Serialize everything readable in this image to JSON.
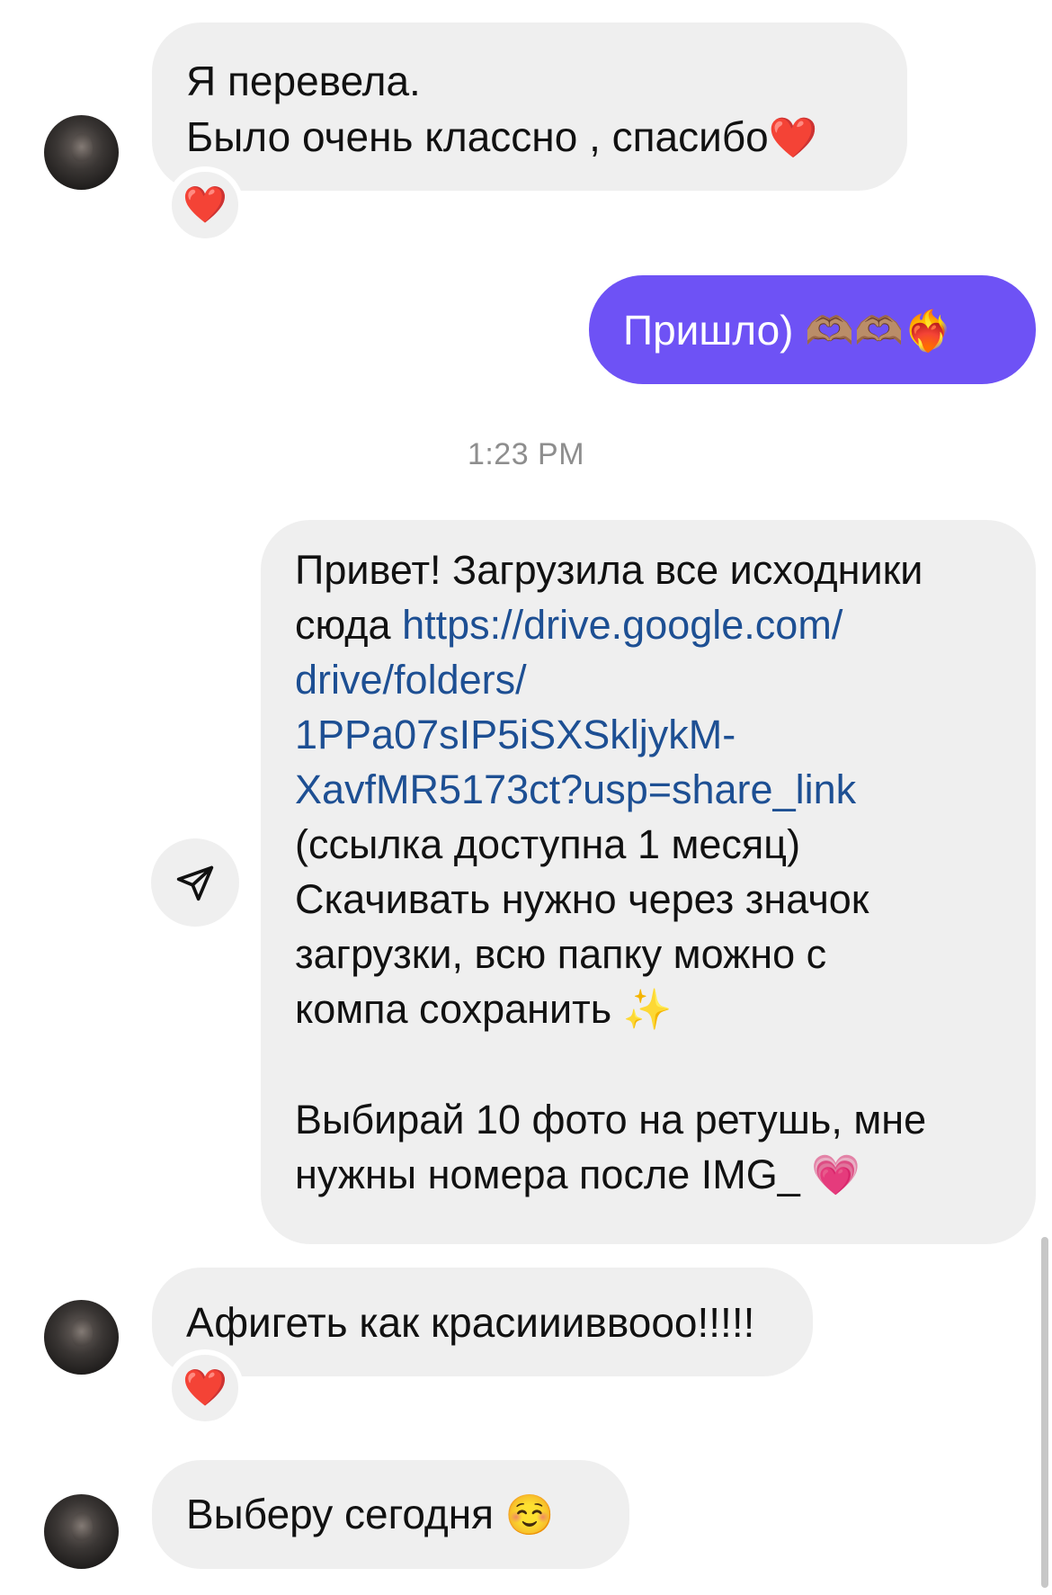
{
  "messages": {
    "m1": {
      "line1": "Я перевела.",
      "line2_text": "Было очень классно , спасибо",
      "line2_emoji": "❤️",
      "reaction": "❤️"
    },
    "m2": {
      "text": "Пришло)",
      "emoji": "🫶🏽🫶🏽❤️‍🔥"
    },
    "timestamp": "1:23 PM",
    "m3": {
      "l1": "Привет! Загрузила все исходники",
      "l2_text": "сюда",
      "l2_link": "https://drive.google.com/",
      "l3_link": "drive/folders/",
      "l4_link": "1PPa07sIP5iSXSkljykM-",
      "l5_link": "XavfMR5173ct?usp=share_link",
      "l6": "(ссылка доступна 1 месяц)",
      "l7": "Скачивать нужно через значок",
      "l8": "загрузки, всю папку можно с",
      "l9_text": "компа сохранить",
      "l9_emoji": "✨",
      "l10": "Выбирай 10 фото на ретушь, мне",
      "l11_text": "нужны номера после IMG_",
      "l11_emoji": "💗"
    },
    "m4": {
      "text": "Афигеть как красиииввооо!!!!!",
      "reaction": "❤️"
    },
    "m5": {
      "text": "Выберу сегодня",
      "emoji": "☺️"
    }
  },
  "colors": {
    "incoming_bubble": "#efefef",
    "outgoing_bubble": "#6e52f5",
    "link": "#1d4f93",
    "timestamp": "#8e8e8e"
  },
  "icons": {
    "share": "paper-plane-icon",
    "avatar": "avatar"
  }
}
